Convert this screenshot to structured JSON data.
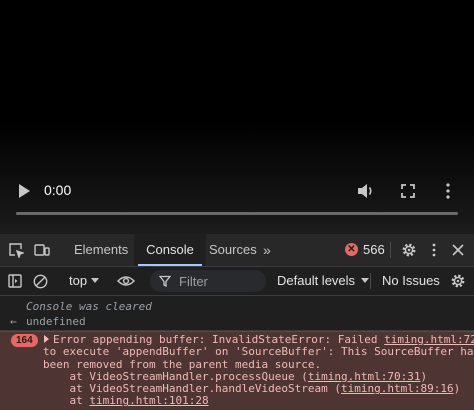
{
  "video": {
    "current_time": "0:00",
    "colors": {
      "background": "#000000",
      "controls": "#c7c7c7"
    }
  },
  "devtools": {
    "tabs": [
      {
        "label": "Elements",
        "active": false
      },
      {
        "label": "Console",
        "active": true
      },
      {
        "label": "Sources",
        "active": false
      }
    ],
    "more_tabs_label": "»",
    "error_count": "566",
    "icons": [
      "inspect-icon",
      "device-toolbar-icon",
      "error-circle-icon",
      "gear-icon",
      "kebab-menu-icon",
      "close-icon"
    ]
  },
  "toolbar": {
    "context": "top",
    "filter_placeholder": "Filter",
    "levels": "Default levels",
    "issues": "No Issues",
    "icons": [
      "sidebar-icon",
      "clear-console-icon",
      "eye-icon",
      "filter-icon",
      "gear-icon"
    ]
  },
  "console": {
    "cleared": "Console was cleared",
    "result_arrow": "←",
    "result": "undefined",
    "error": {
      "count": "164",
      "line1_text": "Error appending buffer: InvalidStateError: Failed ",
      "line1_link": "timing.html:72",
      "line2": "to execute 'appendBuffer' on 'SourceBuffer': This SourceBuffer has",
      "line3": "been removed from the parent media source.",
      "stack": [
        {
          "prefix": "    at VideoStreamHandler.processQueue (",
          "link": "timing.html:70:31",
          "suffix": ")"
        },
        {
          "prefix": "    at VideoStreamHandler.handleVideoStream (",
          "link": "timing.html:89:16",
          "suffix": ")"
        },
        {
          "prefix": "    at ",
          "link": "timing.html:101:28",
          "suffix": ""
        }
      ]
    },
    "colors": {
      "error_bg": "#4e3534",
      "error_text": "#f2b8b5",
      "badge": "#e46962"
    }
  }
}
